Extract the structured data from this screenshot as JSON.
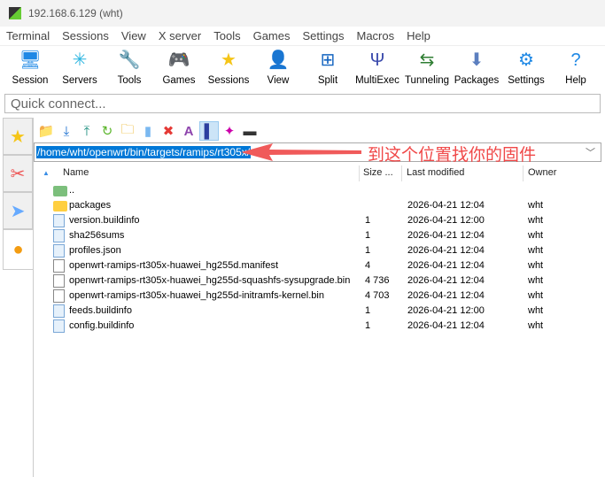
{
  "window": {
    "title": "192.168.6.129 (wht)"
  },
  "menu": [
    "Terminal",
    "Sessions",
    "View",
    "X server",
    "Tools",
    "Games",
    "Settings",
    "Macros",
    "Help"
  ],
  "toolbar": [
    {
      "label": "Session",
      "icon": "monitor-icon",
      "glyph": "🖥"
    },
    {
      "label": "Servers",
      "icon": "servers-icon",
      "glyph": "✳"
    },
    {
      "label": "Tools",
      "icon": "tools-icon",
      "glyph": "🔧"
    },
    {
      "label": "Games",
      "icon": "gamepad-icon",
      "glyph": "🎮"
    },
    {
      "label": "Sessions",
      "icon": "star-icon",
      "glyph": "★"
    },
    {
      "label": "View",
      "icon": "view-icon",
      "glyph": "👤"
    },
    {
      "label": "Split",
      "icon": "split-icon",
      "glyph": "⊞"
    },
    {
      "label": "MultiExec",
      "icon": "fork-icon",
      "glyph": "Ψ"
    },
    {
      "label": "Tunneling",
      "icon": "tunnel-icon",
      "glyph": "⇆"
    },
    {
      "label": "Packages",
      "icon": "package-icon",
      "glyph": "⬇"
    },
    {
      "label": "Settings",
      "icon": "gear-icon",
      "glyph": "⚙"
    },
    {
      "label": "Help",
      "icon": "help-icon",
      "glyph": "?"
    }
  ],
  "quick_connect": {
    "placeholder": "Quick connect..."
  },
  "path": "/home/wht/openwrt/bin/targets/ramips/rt305x/",
  "annotation": "到这个位置找你的固件",
  "columns": {
    "name": "Name",
    "size": "Size ...",
    "modified": "Last modified",
    "owner": "Owner"
  },
  "files": [
    {
      "name": "..",
      "size": "",
      "modified": "",
      "owner": "",
      "type": "up"
    },
    {
      "name": "packages",
      "size": "",
      "modified": "2026-04-21 12:04",
      "owner": "wht",
      "type": "folder"
    },
    {
      "name": "version.buildinfo",
      "size": "1",
      "modified": "2026-04-21 12:00",
      "owner": "wht",
      "type": "doc"
    },
    {
      "name": "sha256sums",
      "size": "1",
      "modified": "2026-04-21 12:04",
      "owner": "wht",
      "type": "doc"
    },
    {
      "name": "profiles.json",
      "size": "1",
      "modified": "2026-04-21 12:04",
      "owner": "wht",
      "type": "doc"
    },
    {
      "name": "openwrt-ramips-rt305x-huawei_hg255d.manifest",
      "size": "4",
      "modified": "2026-04-21 12:04",
      "owner": "wht",
      "type": "plain"
    },
    {
      "name": "openwrt-ramips-rt305x-huawei_hg255d-squashfs-sysupgrade.bin",
      "size": "4 736",
      "modified": "2026-04-21 12:04",
      "owner": "wht",
      "type": "plain"
    },
    {
      "name": "openwrt-ramips-rt305x-huawei_hg255d-initramfs-kernel.bin",
      "size": "4 703",
      "modified": "2026-04-21 12:04",
      "owner": "wht",
      "type": "plain"
    },
    {
      "name": "feeds.buildinfo",
      "size": "1",
      "modified": "2026-04-21 12:00",
      "owner": "wht",
      "type": "doc"
    },
    {
      "name": "config.buildinfo",
      "size": "1",
      "modified": "2026-04-21 12:04",
      "owner": "wht",
      "type": "doc"
    }
  ],
  "colors": {
    "selection": "#0078d7",
    "annotation": "#f04848"
  }
}
